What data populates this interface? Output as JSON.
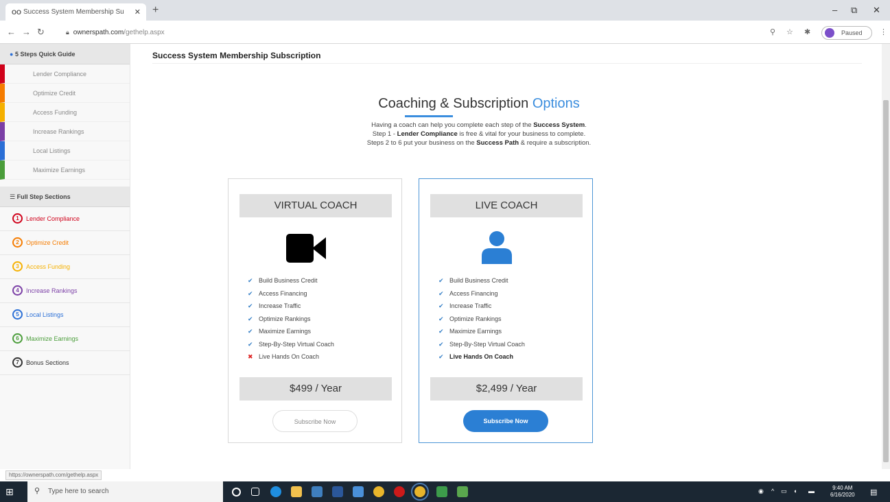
{
  "browser": {
    "tab_title": "Success System Membership Su",
    "tab_favicon": "OO",
    "url_host": "ownerspath.com",
    "url_path": "/gethelp.aspx",
    "profile_label": "Paused"
  },
  "sidebar": {
    "quick_header": "5 Steps Quick Guide",
    "quick_items": [
      {
        "label": "Lender Compliance",
        "color": "#d0021b"
      },
      {
        "label": "Optimize Credit",
        "color": "#f57c00"
      },
      {
        "label": "Access Funding",
        "color": "#f5b000"
      },
      {
        "label": "Increase Rankings",
        "color": "#7b3fa6"
      },
      {
        "label": "Local Listings",
        "color": "#2b6fd6"
      },
      {
        "label": "Maximize Earnings",
        "color": "#4a9d3a"
      }
    ],
    "full_header": "Full Step Sections",
    "steps": [
      {
        "num": "1",
        "label": "Lender Compliance",
        "color": "#d0021b"
      },
      {
        "num": "2",
        "label": "Optimize Credit",
        "color": "#f57c00"
      },
      {
        "num": "3",
        "label": "Access Funding",
        "color": "#f5b000"
      },
      {
        "num": "4",
        "label": "Increase Rankings",
        "color": "#7b3fa6"
      },
      {
        "num": "5",
        "label": "Local Listings",
        "color": "#2b6fd6"
      },
      {
        "num": "6",
        "label": "Maximize Earnings",
        "color": "#4a9d3a"
      },
      {
        "num": "7",
        "label": "Bonus Sections",
        "color": "#333333"
      }
    ]
  },
  "main": {
    "page_title": "Success System Membership Subscription",
    "section_title": "Coaching & Subscription",
    "section_title_accent": "Options",
    "intro": {
      "line1_a": "Having a coach can help you complete each step of the ",
      "line1_b": "Success System",
      "line1_c": ".",
      "line2_a": "Step 1 - ",
      "line2_b": "Lender Compliance",
      "line2_c": " is free & vital for your business to complete.",
      "line3_a": "Steps 2 to 6 put your business on the ",
      "line3_b": "Success Path",
      "line3_c": " & require a subscription."
    },
    "plans": [
      {
        "title": "VIRTUAL COACH",
        "icon": "video-camera-icon",
        "features": [
          {
            "text": "Build Business Credit",
            "included": true
          },
          {
            "text": "Access Financing",
            "included": true
          },
          {
            "text": "Increase Traffic",
            "included": true
          },
          {
            "text": "Optimize Rankings",
            "included": true
          },
          {
            "text": "Maximize Earnings",
            "included": true
          },
          {
            "text": "Step-By-Step Virtual Coach",
            "included": true
          },
          {
            "text": "Live Hands On Coach",
            "included": false
          }
        ],
        "price": "$499 / Year",
        "button": "Subscribe Now"
      },
      {
        "title": "LIVE COACH",
        "icon": "person-icon",
        "features": [
          {
            "text": "Build Business Credit",
            "included": true
          },
          {
            "text": "Access Financing",
            "included": true
          },
          {
            "text": "Increase Traffic",
            "included": true
          },
          {
            "text": "Optimize Rankings",
            "included": true
          },
          {
            "text": "Maximize Earnings",
            "included": true
          },
          {
            "text": "Step-By-Step Virtual Coach",
            "included": true
          },
          {
            "text": "Live Hands On Coach",
            "included": true
          }
        ],
        "price": "$2,499 / Year",
        "button": "Subscribe Now"
      }
    ]
  },
  "status_url": "https://ownerspath.com/gethelp.aspx",
  "taskbar": {
    "search_placeholder": "Type here to search",
    "time": "9:40 AM",
    "date": "6/16/2020"
  },
  "colors": {
    "accent": "#3a8dde",
    "button_primary": "#2b7fd4",
    "check": "#3a82c8",
    "cross": "#dd2222"
  }
}
